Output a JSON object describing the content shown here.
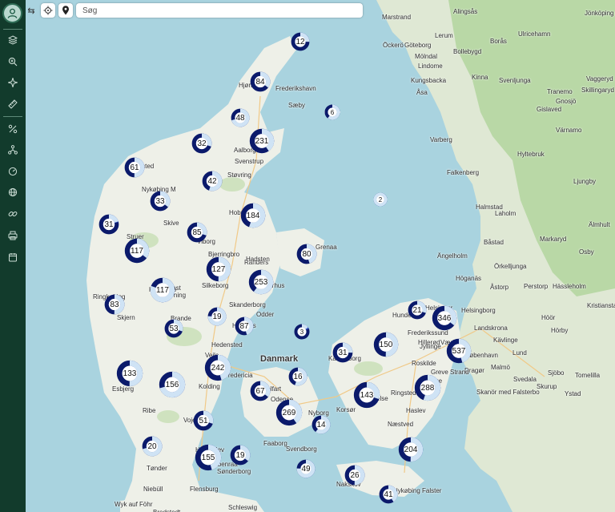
{
  "sidebar": {
    "items": [
      {
        "name": "layers-icon"
      },
      {
        "name": "zoom-search-icon"
      },
      {
        "name": "compass-icon"
      },
      {
        "name": "ruler-icon"
      },
      {
        "name": "percent-icon"
      },
      {
        "name": "network-icon"
      },
      {
        "name": "gauge-icon"
      },
      {
        "name": "globe-icon"
      },
      {
        "name": "link-icon"
      },
      {
        "name": "printer-icon"
      },
      {
        "name": "calendar-icon"
      }
    ]
  },
  "toolbar": {
    "collapse_label": "⇆",
    "search": {
      "placeholder": "Søg",
      "value": ""
    }
  },
  "map": {
    "places": [
      {
        "name": "Marstrand",
        "cls": ""
      },
      {
        "name": "Alingsås",
        "cls": ""
      },
      {
        "name": "Lerum",
        "cls": ""
      },
      {
        "name": "Öckerö",
        "cls": ""
      },
      {
        "name": "Göteborg",
        "cls": ""
      },
      {
        "name": "Borås",
        "cls": ""
      },
      {
        "name": "Ulricehamn",
        "cls": ""
      },
      {
        "name": "Jönköping",
        "cls": ""
      },
      {
        "name": "Mölndal",
        "cls": ""
      },
      {
        "name": "Bollebygd",
        "cls": ""
      },
      {
        "name": "Lindome",
        "cls": ""
      },
      {
        "name": "Kungsbacka",
        "cls": ""
      },
      {
        "name": "Kinna",
        "cls": ""
      },
      {
        "name": "Svenljunga",
        "cls": ""
      },
      {
        "name": "Vaggeryd",
        "cls": ""
      },
      {
        "name": "Skillingaryd",
        "cls": ""
      },
      {
        "name": "Åsa",
        "cls": ""
      },
      {
        "name": "Tranemo",
        "cls": ""
      },
      {
        "name": "Gnosjö",
        "cls": ""
      },
      {
        "name": "Gislaved",
        "cls": ""
      },
      {
        "name": "Värnamo",
        "cls": ""
      },
      {
        "name": "Varberg",
        "cls": ""
      },
      {
        "name": "Hyltebruk",
        "cls": ""
      },
      {
        "name": "Falkenberg",
        "cls": ""
      },
      {
        "name": "Ljungby",
        "cls": ""
      },
      {
        "name": "Halmstad",
        "cls": ""
      },
      {
        "name": "Laholm",
        "cls": ""
      },
      {
        "name": "Älmhult",
        "cls": ""
      },
      {
        "name": "Båstad",
        "cls": ""
      },
      {
        "name": "Markaryd",
        "cls": ""
      },
      {
        "name": "Osby",
        "cls": ""
      },
      {
        "name": "Ängelholm",
        "cls": ""
      },
      {
        "name": "Örkelljunga",
        "cls": ""
      },
      {
        "name": "Perstorp",
        "cls": ""
      },
      {
        "name": "Hässleholm",
        "cls": ""
      },
      {
        "name": "Höganäs",
        "cls": ""
      },
      {
        "name": "Åstorp",
        "cls": ""
      },
      {
        "name": "Kristianstad",
        "cls": ""
      },
      {
        "name": "Helsingborg",
        "cls": ""
      },
      {
        "name": "Landskrona",
        "cls": ""
      },
      {
        "name": "Höör",
        "cls": ""
      },
      {
        "name": "Hörby",
        "cls": ""
      },
      {
        "name": "Kävlinge",
        "cls": ""
      },
      {
        "name": "Lund",
        "cls": ""
      },
      {
        "name": "Malmö",
        "cls": ""
      },
      {
        "name": "Sjöbo",
        "cls": ""
      },
      {
        "name": "Tomelilla",
        "cls": ""
      },
      {
        "name": "Svedala",
        "cls": ""
      },
      {
        "name": "Skurup",
        "cls": ""
      },
      {
        "name": "Skanör med Falsterbo",
        "cls": ""
      },
      {
        "name": "Ystad",
        "cls": ""
      },
      {
        "name": "Dragør",
        "cls": ""
      },
      {
        "name": "Hjørring",
        "cls": ""
      },
      {
        "name": "Frederikshavn",
        "cls": ""
      },
      {
        "name": "Sæby",
        "cls": ""
      },
      {
        "name": "Aalborg",
        "cls": ""
      },
      {
        "name": "Svenstrup",
        "cls": ""
      },
      {
        "name": "Thisted",
        "cls": ""
      },
      {
        "name": "Støvring",
        "cls": ""
      },
      {
        "name": "Nykøbing M",
        "cls": ""
      },
      {
        "name": "Skive",
        "cls": ""
      },
      {
        "name": "Hobro",
        "cls": ""
      },
      {
        "name": "Struer",
        "cls": ""
      },
      {
        "name": "Viborg",
        "cls": ""
      },
      {
        "name": "Randers",
        "cls": ""
      },
      {
        "name": "Grenaa",
        "cls": ""
      },
      {
        "name": "Bjerringbro",
        "cls": ""
      },
      {
        "name": "Hadsten",
        "cls": ""
      },
      {
        "name": "Holstebro",
        "cls": ""
      },
      {
        "name": "Herning",
        "cls": ""
      },
      {
        "name": "Ikast",
        "cls": ""
      },
      {
        "name": "Silkeborg",
        "cls": ""
      },
      {
        "name": "Aarhus",
        "cls": ""
      },
      {
        "name": "Ringkøbing",
        "cls": ""
      },
      {
        "name": "Skanderborg",
        "cls": ""
      },
      {
        "name": "Odder",
        "cls": ""
      },
      {
        "name": "Skjern",
        "cls": ""
      },
      {
        "name": "Brande",
        "cls": ""
      },
      {
        "name": "Horsens",
        "cls": ""
      },
      {
        "name": "Hedensted",
        "cls": ""
      },
      {
        "name": "Danmark",
        "cls": "big"
      },
      {
        "name": "Kalundborg",
        "cls": ""
      },
      {
        "name": "Hundested",
        "cls": ""
      },
      {
        "name": "Helsingør",
        "cls": ""
      },
      {
        "name": "Frederikssund",
        "cls": ""
      },
      {
        "name": "Hillerød",
        "cls": ""
      },
      {
        "name": "Værløse",
        "cls": ""
      },
      {
        "name": "Jyllinge",
        "cls": ""
      },
      {
        "name": "Roskilde",
        "cls": ""
      },
      {
        "name": "København",
        "cls": ""
      },
      {
        "name": "Greve Strand",
        "cls": ""
      },
      {
        "name": "Vejle",
        "cls": ""
      },
      {
        "name": "Fredericia",
        "cls": ""
      },
      {
        "name": "Kolding",
        "cls": ""
      },
      {
        "name": "Esbjerg",
        "cls": ""
      },
      {
        "name": "Middelfart",
        "cls": ""
      },
      {
        "name": "Odense",
        "cls": ""
      },
      {
        "name": "Nyborg",
        "cls": ""
      },
      {
        "name": "Korsør",
        "cls": ""
      },
      {
        "name": "Slagelse",
        "cls": ""
      },
      {
        "name": "Ringsted",
        "cls": ""
      },
      {
        "name": "Køge",
        "cls": ""
      },
      {
        "name": "Haslev",
        "cls": ""
      },
      {
        "name": "Ribe",
        "cls": ""
      },
      {
        "name": "Vojens",
        "cls": ""
      },
      {
        "name": "Næstved",
        "cls": ""
      },
      {
        "name": "Faaborg",
        "cls": ""
      },
      {
        "name": "Svendborg",
        "cls": ""
      },
      {
        "name": "Haderslev",
        "cls": ""
      },
      {
        "name": "Aabenraa",
        "cls": ""
      },
      {
        "name": "Sønderborg",
        "cls": ""
      },
      {
        "name": "Tønder",
        "cls": ""
      },
      {
        "name": "Niebüll",
        "cls": ""
      },
      {
        "name": "Flensburg",
        "cls": ""
      },
      {
        "name": "Nakskov",
        "cls": ""
      },
      {
        "name": "Nykøbing Falster",
        "cls": ""
      },
      {
        "name": "Wyk auf Föhr",
        "cls": ""
      },
      {
        "name": "Bredstedt",
        "cls": ""
      },
      {
        "name": "Schleswig",
        "cls": ""
      }
    ],
    "clusters": [
      {
        "count": "12",
        "light": 0.25
      },
      {
        "count": "84",
        "light": 0.35
      },
      {
        "count": "6",
        "light": 0.6
      },
      {
        "count": "48",
        "light": 0.7
      },
      {
        "count": "231",
        "light": 0.4
      },
      {
        "count": "32",
        "light": 0.3
      },
      {
        "count": "61",
        "light": 0.5
      },
      {
        "count": "42",
        "light": 0.55
      },
      {
        "count": "33",
        "light": 0.35
      },
      {
        "count": "2",
        "light": 1.0
      },
      {
        "count": "184",
        "light": 0.55
      },
      {
        "count": "31",
        "light": 0.2
      },
      {
        "count": "85",
        "light": 0.3
      },
      {
        "count": "117",
        "light": 0.35
      },
      {
        "count": "80",
        "light": 0.45
      },
      {
        "count": "127",
        "light": 0.5
      },
      {
        "count": "253",
        "light": 0.6
      },
      {
        "count": "117",
        "light": 0.8
      },
      {
        "count": "83",
        "light": 0.5
      },
      {
        "count": "19",
        "light": 0.75
      },
      {
        "count": "53",
        "light": 0.3
      },
      {
        "count": "87",
        "light": 0.45
      },
      {
        "count": "3",
        "light": 0.15
      },
      {
        "count": "21",
        "light": 0.3
      },
      {
        "count": "346",
        "light": 0.35
      },
      {
        "count": "31",
        "light": 0.25
      },
      {
        "count": "150",
        "light": 0.5
      },
      {
        "count": "537",
        "light": 0.45
      },
      {
        "count": "133",
        "light": 0.5
      },
      {
        "count": "156",
        "light": 0.7
      },
      {
        "count": "242",
        "light": 0.45
      },
      {
        "count": "16",
        "light": 0.55
      },
      {
        "count": "67",
        "light": 0.35
      },
      {
        "count": "143",
        "light": 0.3
      },
      {
        "count": "288",
        "light": 0.55
      },
      {
        "count": "269",
        "light": 0.4
      },
      {
        "count": "14",
        "light": 0.6
      },
      {
        "count": "51",
        "light": 0.3
      },
      {
        "count": "20",
        "light": 0.7
      },
      {
        "count": "204",
        "light": 0.5
      },
      {
        "count": "155",
        "light": 0.45
      },
      {
        "count": "19",
        "light": 0.35
      },
      {
        "count": "49",
        "light": 0.75
      },
      {
        "count": "26",
        "light": 0.5
      },
      {
        "count": "41",
        "light": 0.4
      }
    ],
    "colors": {
      "dark": "#0b1a6b",
      "mid": "#3a5bc4",
      "light": "#cfe3f5",
      "land_dk": "#eef0e8",
      "land_se": "#dfe8d4",
      "forest": "#b9d8a6",
      "water": "#a9d3df"
    }
  }
}
